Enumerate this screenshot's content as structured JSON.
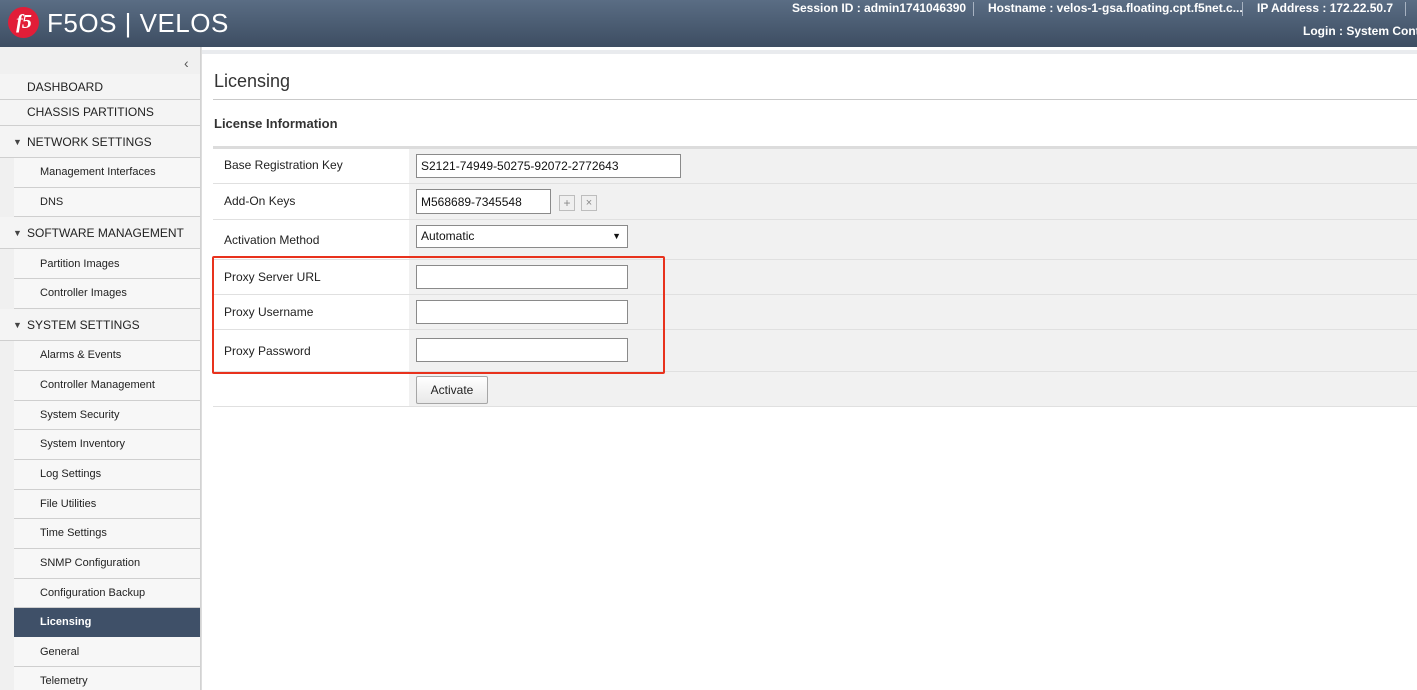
{
  "header": {
    "logo_text": "f5",
    "product": "F5OS | VELOS",
    "session_id": "Session ID : admin1741046390",
    "hostname": "Hostname : velos-1-gsa.floating.cpt.f5net.c...",
    "ip_address": "IP Address : 172.22.50.7",
    "login": "Login : System Contro"
  },
  "sidebar": {
    "collapse_icon": "chevron-left-icon",
    "items": [
      {
        "label": "DASHBOARD"
      },
      {
        "label": "CHASSIS PARTITIONS"
      },
      {
        "label": "NETWORK SETTINGS",
        "expanded": true
      },
      {
        "label": "Management Interfaces"
      },
      {
        "label": "DNS"
      },
      {
        "label": "SOFTWARE MANAGEMENT",
        "expanded": true
      },
      {
        "label": "Partition Images"
      },
      {
        "label": "Controller Images"
      },
      {
        "label": "SYSTEM SETTINGS",
        "expanded": true
      },
      {
        "label": "Alarms & Events"
      },
      {
        "label": "Controller Management"
      },
      {
        "label": "System Security"
      },
      {
        "label": "System Inventory"
      },
      {
        "label": "Log Settings"
      },
      {
        "label": "File Utilities"
      },
      {
        "label": "Time Settings"
      },
      {
        "label": "SNMP Configuration"
      },
      {
        "label": "Configuration Backup"
      },
      {
        "label": "Licensing",
        "active": true
      },
      {
        "label": "General"
      },
      {
        "label": "Telemetry"
      }
    ]
  },
  "main": {
    "title": "Licensing",
    "section_title": "License Information",
    "form": {
      "base_key_label": "Base Registration Key",
      "base_key_value": "S2121-74949-50275-92072-2772643",
      "addon_label": "Add-On Keys",
      "addon_value": "M568689-7345548",
      "add_icon": "plus-icon",
      "remove_icon": "close-icon",
      "activation_label": "Activation Method",
      "activation_value": "Automatic",
      "proxy_url_label": "Proxy Server URL",
      "proxy_url_value": "",
      "proxy_user_label": "Proxy Username",
      "proxy_user_value": "",
      "proxy_pass_label": "Proxy Password",
      "proxy_pass_value": "",
      "activate_label": "Activate"
    },
    "highlight_color": "#e8321d"
  }
}
